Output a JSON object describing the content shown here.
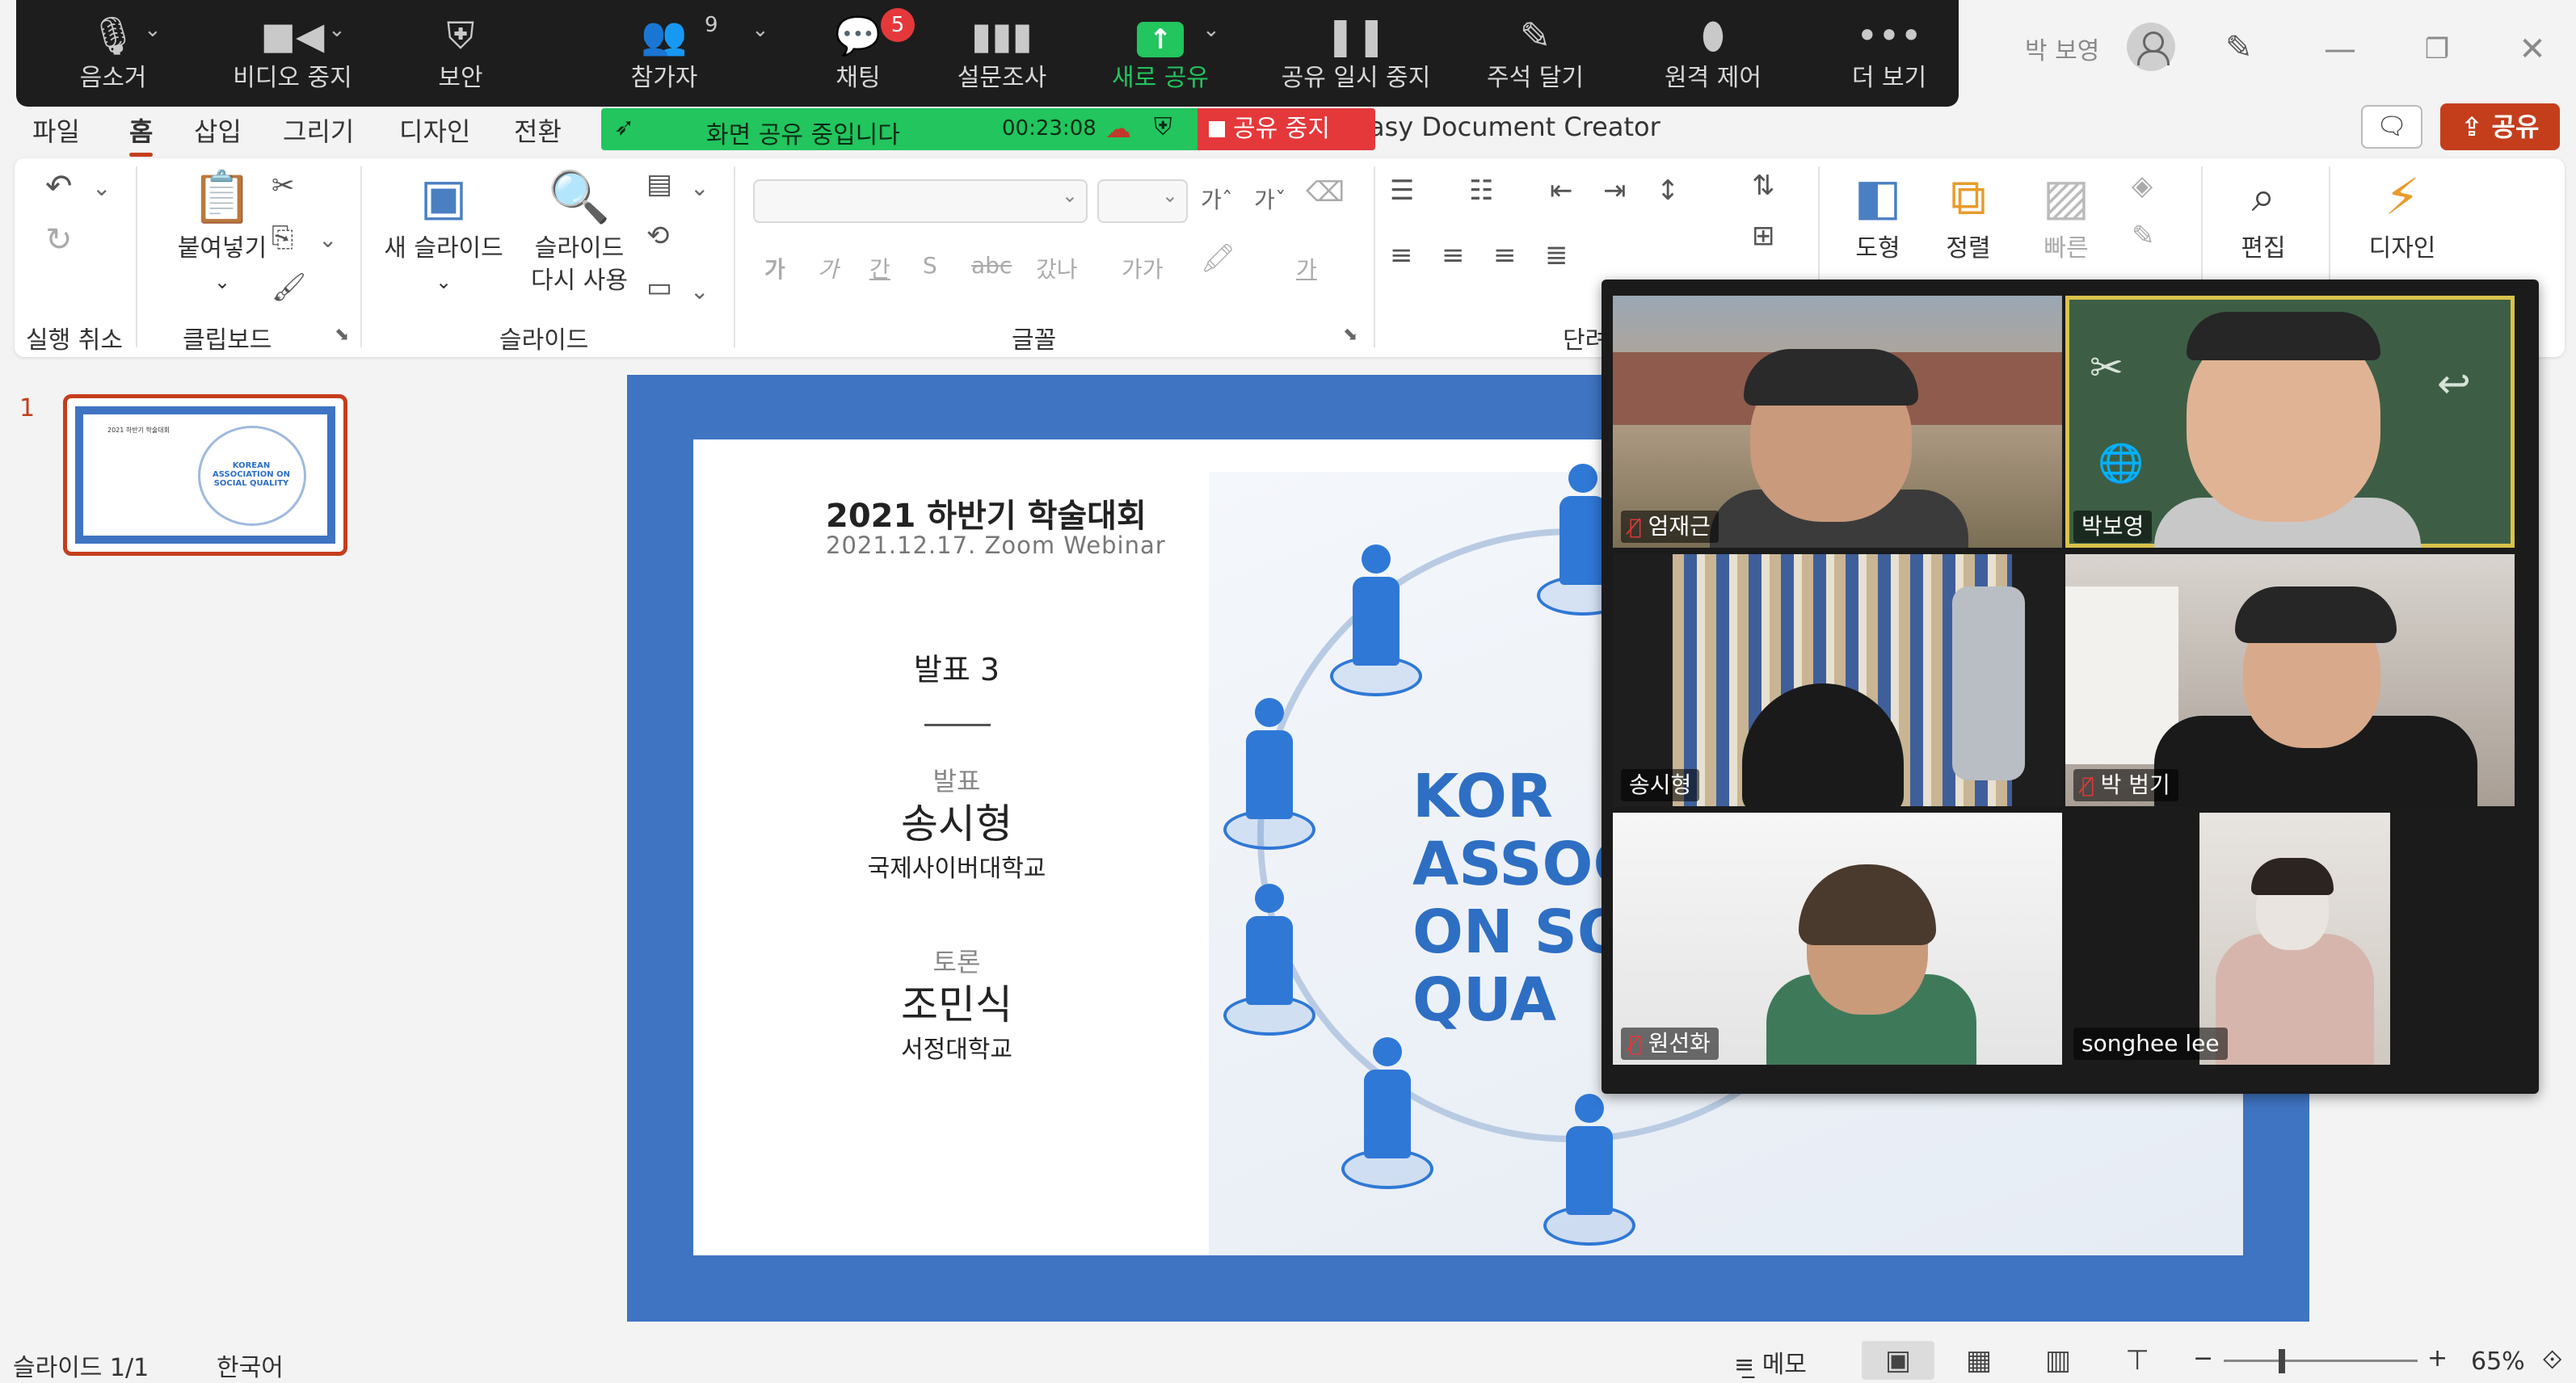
{
  "zoom_toolbar": {
    "items": [
      {
        "label": "음소거",
        "icon": "microphone-icon"
      },
      {
        "label": "비디오 중지",
        "icon": "video-camera-icon"
      },
      {
        "label": "보안",
        "icon": "shield-icon"
      },
      {
        "label": "참가자",
        "icon": "participants-icon"
      },
      {
        "label": "채팅",
        "icon": "chat-icon"
      },
      {
        "label": "설문조사",
        "icon": "bar-chart-icon"
      },
      {
        "label": "새로 공유",
        "icon": "share-screen-icon"
      },
      {
        "label": "공유 일시 중지",
        "icon": "pause-icon"
      },
      {
        "label": "주석 달기",
        "icon": "pencil-icon"
      },
      {
        "label": "원격 제어",
        "icon": "mouse-icon"
      },
      {
        "label": "더 보기",
        "icon": "more-icon"
      }
    ],
    "participants_count": "9",
    "chat_badge": "5",
    "share_color": "#22c55e"
  },
  "share_status": {
    "text": "화면 공유 중입니다",
    "timer": "00:23:08",
    "stop_label": "공유 중지"
  },
  "titlebar": {
    "user_name": "박 보영",
    "document_title": "asy Document Creator"
  },
  "menu": {
    "tabs": [
      "파일",
      "홈",
      "삽입",
      "그리기",
      "디자인",
      "전환"
    ],
    "active_tab": "홈",
    "share_label": "공유",
    "accent_color": "#c43e1c"
  },
  "ribbon": {
    "groups": {
      "undo": "실행 취소",
      "clipboard": "클립보드",
      "slides": "슬라이드",
      "font": "글꼴",
      "paragraph": "단려"
    },
    "buttons": {
      "paste": "붙여넣기",
      "new_slide": "새 슬라이드",
      "reuse_slide_1": "슬라이드",
      "reuse_slide_2": "다시 사용",
      "shapes": "도형",
      "arrange": "정렬",
      "quick_styles": "빠른",
      "editing": "편집",
      "designer": "디자인"
    },
    "font_glyphs": {
      "bold": "가",
      "italic": "가",
      "underline": "간",
      "shadow": "S",
      "strike": "ꟷ",
      "spacing": "갔나",
      "case": "가가",
      "color": "가",
      "grow": "가ˆ",
      "shrink": "가ˇ"
    }
  },
  "thumbnail": {
    "number": "1",
    "title": "2021 하반기 학술대회",
    "blue_text": "KOREAN ASSOCIATION ON SOCIAL QUALITY"
  },
  "slide": {
    "title": "2021 하반기 학술대회",
    "subtitle": "2021.12.17. Zoom Webinar",
    "session": "발표 3",
    "presenter_role": "발표",
    "presenter_name": "송시형",
    "presenter_affiliation": "국제사이버대학교",
    "discussant_role": "토론",
    "discussant_name": "조민식",
    "discussant_affiliation": "서정대학교",
    "association_text": "KOR\nASSOC\nON SO\nQUA",
    "frame_color": "#3f74c2"
  },
  "video_gallery": {
    "participants": [
      {
        "name": "엄재근",
        "muted": true
      },
      {
        "name": "박보영",
        "muted": false,
        "active": true
      },
      {
        "name": "송시형",
        "muted": false
      },
      {
        "name": "박 범기",
        "muted": true
      },
      {
        "name": "원선화",
        "muted": true
      },
      {
        "name": "songhee lee",
        "muted": false
      }
    ]
  },
  "statusbar": {
    "slide_indicator": "슬라이드 1/1",
    "language": "한국어",
    "notes_label": "메모",
    "zoom_level": "65%"
  }
}
